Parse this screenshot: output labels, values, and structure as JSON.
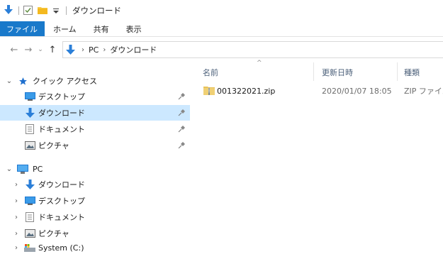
{
  "window": {
    "title": "ダウンロード"
  },
  "ribbon": {
    "tabs": [
      {
        "label": "ファイル"
      },
      {
        "label": "ホーム"
      },
      {
        "label": "共有"
      },
      {
        "label": "表示"
      }
    ]
  },
  "address": {
    "crumbs": [
      "PC",
      "ダウンロード"
    ]
  },
  "nav": {
    "quick_access": "クイック アクセス",
    "quick_items": [
      {
        "label": "デスクトップ",
        "icon": "desktop-icon"
      },
      {
        "label": "ダウンロード",
        "icon": "download-icon"
      },
      {
        "label": "ドキュメント",
        "icon": "document-icon"
      },
      {
        "label": "ピクチャ",
        "icon": "pictures-icon"
      }
    ],
    "pc": "PC",
    "pc_items": [
      {
        "label": "ダウンロード",
        "icon": "download-icon"
      },
      {
        "label": "デスクトップ",
        "icon": "desktop-icon"
      },
      {
        "label": "ドキュメント",
        "icon": "document-icon"
      },
      {
        "label": "ピクチャ",
        "icon": "pictures-icon"
      },
      {
        "label": "System (C:)",
        "icon": "drive-icon"
      }
    ]
  },
  "content": {
    "columns": {
      "name": "名前",
      "modified": "更新日時",
      "type": "種類"
    },
    "files": [
      {
        "name": "001322021.zip",
        "modified": "2020/01/07 18:05",
        "type": "ZIP ファイル"
      }
    ]
  },
  "colors": {
    "accent": "#1979ca",
    "selection": "#cce8ff",
    "download_arrow": "#2b7fd8",
    "quick_access_star": "#1e6fce"
  }
}
